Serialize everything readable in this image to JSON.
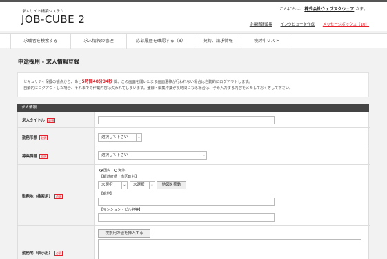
{
  "header": {
    "logo_sub": "求人サイト構築システム",
    "logo": "JOB-CUBE 2",
    "greeting_prefix": "こんにちは、",
    "company": "株式会社ウェブスクウェア",
    "greeting_suffix": " さま。",
    "links": [
      "企業情報編集",
      "インタビューを作成",
      "メッセージボックス（10）"
    ]
  },
  "nav": {
    "items": [
      "求職者を検索する",
      "求人情報の管理",
      "応募履歴を確認する（8）",
      "契約、請求情報",
      "検討中リスト"
    ]
  },
  "page": {
    "title": "中途採用 - 求人情報登録"
  },
  "notice": {
    "line1_a": "セキュリティ保護の観点から、あと",
    "time": "5時間48分34秒",
    "line1_b": " 間、この画面を開いたまま画面遷移が行われない場合は自動的にログアウトします。",
    "line2": "自動的にログアウトした場合、それまでの作業内容は失われてしまいます。登録・編集作業が長時間になる場合は、予め入力する内容をメモしておく等して下さい。"
  },
  "form": {
    "section_title": "求人情報",
    "required_label": "必須",
    "fields": {
      "title": "求人タイトル",
      "employment": "勤務形態",
      "job_type": "募集職種",
      "location_search": "勤務地（検索用）",
      "location_display": "勤務地（表示用）"
    },
    "select_placeholder": "選択して下さい",
    "radio_domestic": "国内",
    "radio_overseas": "海外",
    "pref_city_label": "【都道府県・市区町村】",
    "unselected": "未選択",
    "map_button": "地図を移動",
    "address_label": "【番地】",
    "building_label": "【マンション・ビル名等】",
    "insert_button": "検索用の値を挿入する"
  }
}
